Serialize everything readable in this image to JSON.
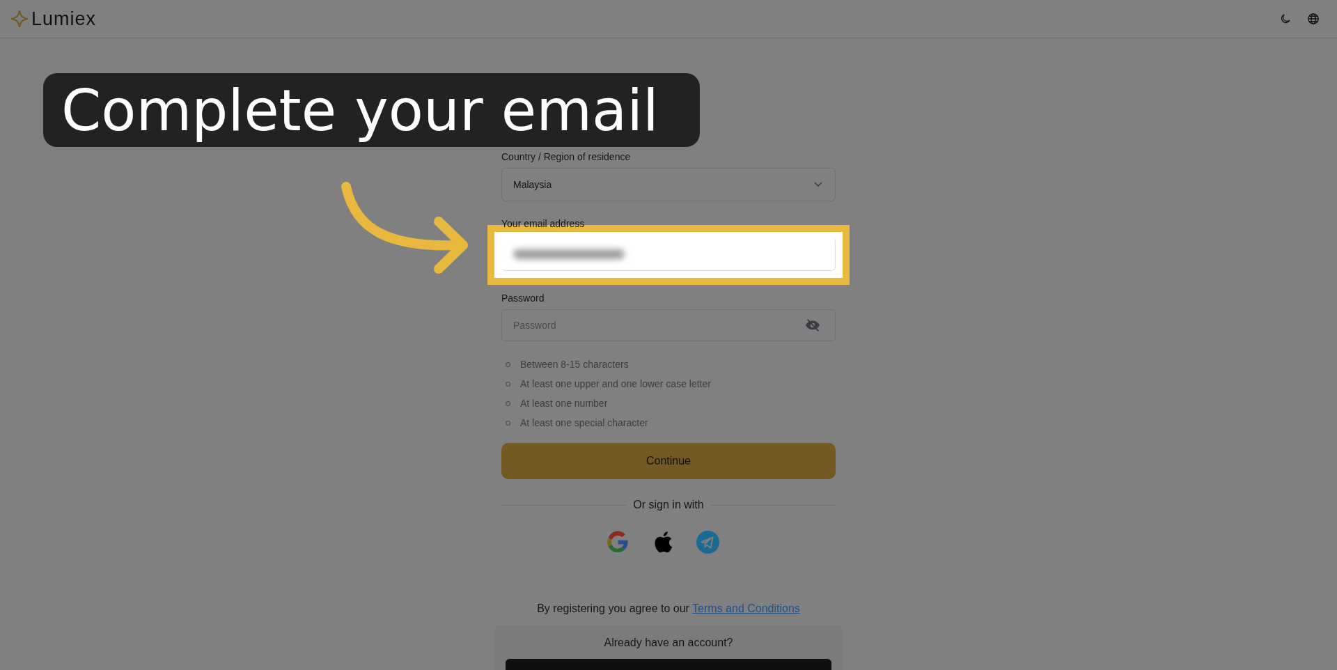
{
  "header": {
    "logo": "Lumiex"
  },
  "callout": {
    "text": "Complete your email"
  },
  "form": {
    "country": {
      "label": "Country / Region of residence",
      "value": "Malaysia"
    },
    "email": {
      "label": "Your email address",
      "value_blurred": true,
      "highlighted": true
    },
    "password": {
      "label": "Password",
      "placeholder": "Password"
    },
    "requirements": [
      "Between 8-15 characters",
      "At least one upper and one lower case letter",
      "At least one number",
      "At least one special character"
    ],
    "continue": "Continue",
    "divider": "Or sign in with",
    "social": [
      {
        "kind": "google"
      },
      {
        "kind": "apple"
      },
      {
        "kind": "telegram"
      }
    ],
    "terms": {
      "text": "By registering you agree to our",
      "link": "Terms and Conditions"
    },
    "login_prompt": "Already have an account?"
  }
}
